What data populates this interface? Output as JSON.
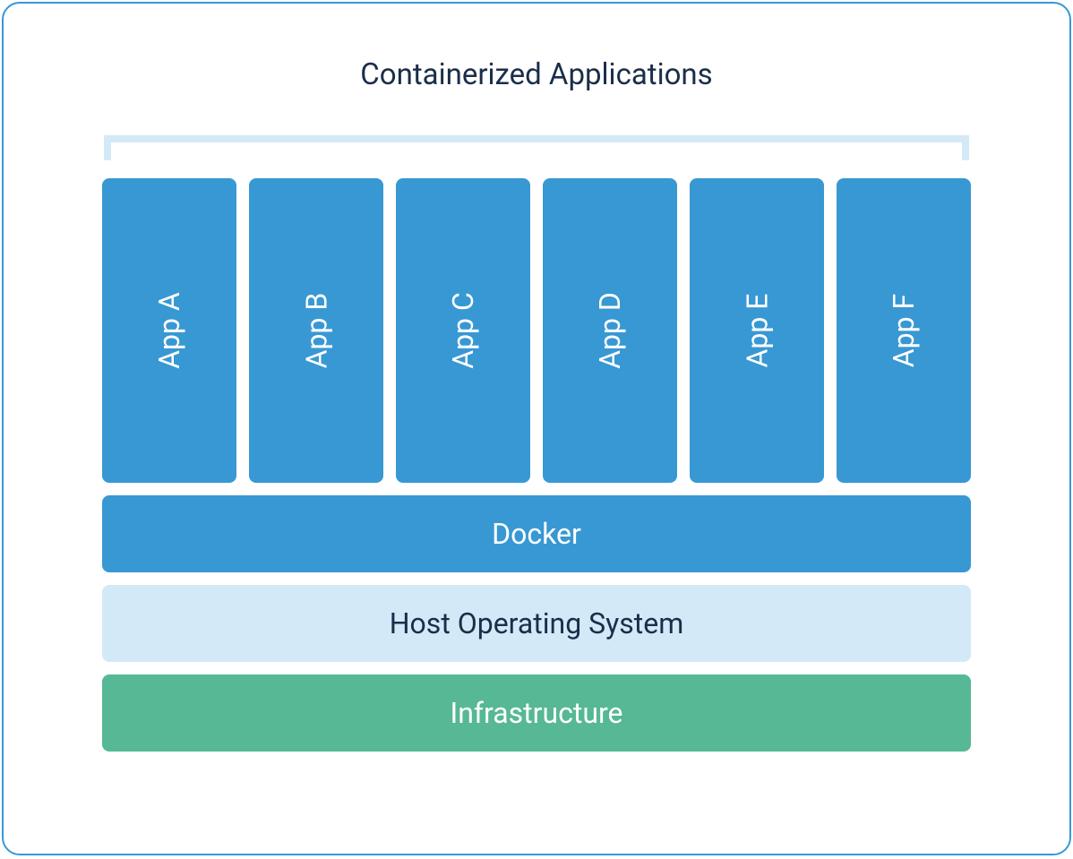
{
  "title": "Containerized Applications",
  "apps": [
    {
      "label": "App A"
    },
    {
      "label": "App B"
    },
    {
      "label": "App C"
    },
    {
      "label": "App D"
    },
    {
      "label": "App E"
    },
    {
      "label": "App F"
    }
  ],
  "layers": {
    "docker": "Docker",
    "host": "Host Operating System",
    "infrastructure": "Infrastructure"
  },
  "colors": {
    "border": "#3898d3",
    "app_bg": "#3898d3",
    "docker_bg": "#3898d3",
    "host_bg": "#d4e9f7",
    "infra_bg": "#56b894",
    "title_text": "#1a2e4a",
    "white_text": "#ffffff"
  }
}
